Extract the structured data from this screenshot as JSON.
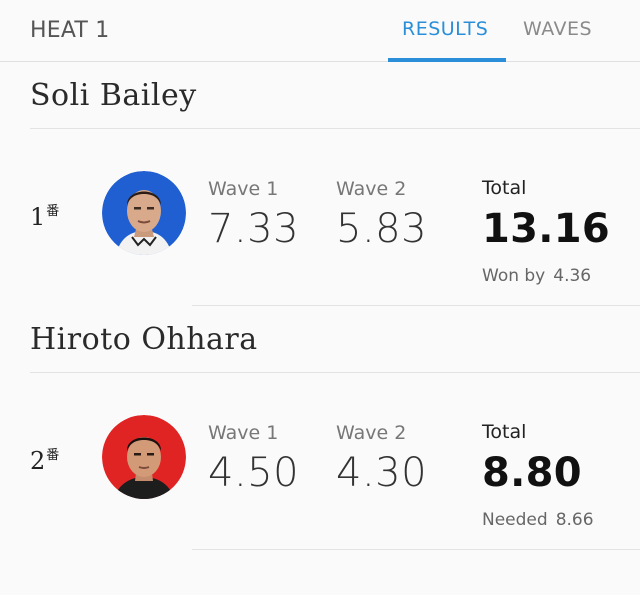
{
  "header": {
    "heat_title": "HEAT 1",
    "tabs": [
      {
        "label": "RESULTS",
        "active": true
      },
      {
        "label": "WAVES",
        "active": false
      }
    ],
    "accent_color": "#2a8fd8"
  },
  "surfers": [
    {
      "name": "Soli Bailey",
      "rank": "1",
      "rank_suffix": "番",
      "avatar_bg": "#1f5fd1",
      "wave1_label": "Wave 1",
      "wave1_score": "7.33",
      "wave2_label": "Wave 2",
      "wave2_score": "5.83",
      "total_label": "Total",
      "total_score": "13.16",
      "note_label": "Won by",
      "note_value": "4.36"
    },
    {
      "name": "Hiroto Ohhara",
      "rank": "2",
      "rank_suffix": "番",
      "avatar_bg": "#e02424",
      "wave1_label": "Wave 1",
      "wave1_score": "4.50",
      "wave2_label": "Wave 2",
      "wave2_score": "4.30",
      "total_label": "Total",
      "total_score": "8.80",
      "note_label": "Needed",
      "note_value": "8.66"
    }
  ]
}
